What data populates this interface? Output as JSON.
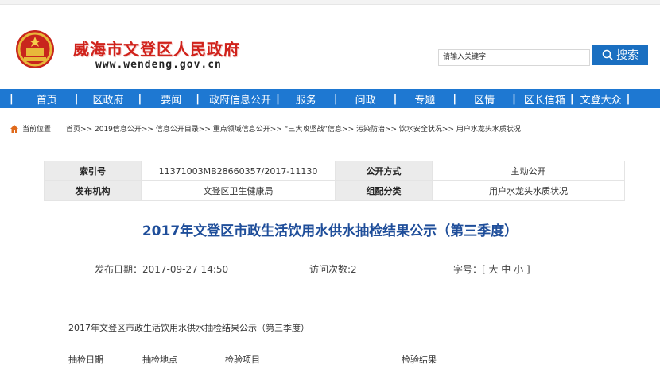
{
  "header": {
    "title": "威海市文登区人民政府",
    "url": "www.wendeng.gov.cn",
    "search_placeholder": "请输入关键字",
    "search_button": "搜索"
  },
  "nav": {
    "items": [
      "首页",
      "区政府",
      "要闻",
      "政府信息公开",
      "服务",
      "问政",
      "专题",
      "区情",
      "区长信箱",
      "文登大众"
    ]
  },
  "breadcrumb": {
    "label": "当前位置:",
    "path": "首页>> 2019信息公开>> 信息公开目录>> 重点领域信息公开>> “三大攻坚战”信息>> 污染防治>> 饮水安全状况>> 用户水龙头水质状况"
  },
  "info_table": {
    "index_label": "索引号",
    "index_value": "11371003MB28660357/2017-11130",
    "public_mode_label": "公开方式",
    "public_mode_value": "主动公开",
    "publisher_label": "发布机构",
    "publisher_value": "文登区卫生健康局",
    "category_label": "组配分类",
    "category_value": "用户水龙头水质状况"
  },
  "article": {
    "title": "2017年文登区市政生活饮用水供水抽检结果公示（第三季度）",
    "publish_date": "发布日期：2017-09-27 14:50",
    "visits": "访问次数:2",
    "font_size": "字号：[ 大 中 小 ]",
    "body_heading": "2017年文登区市政生活饮用水供水抽检结果公示（第三季度）",
    "columns": [
      "抽检日期",
      "抽检地点",
      "检验项目",
      "检验结果"
    ]
  },
  "colors": {
    "nav_bg": "#1e78d2",
    "title_red": "#d0221b",
    "article_blue": "#1f4e9a"
  }
}
